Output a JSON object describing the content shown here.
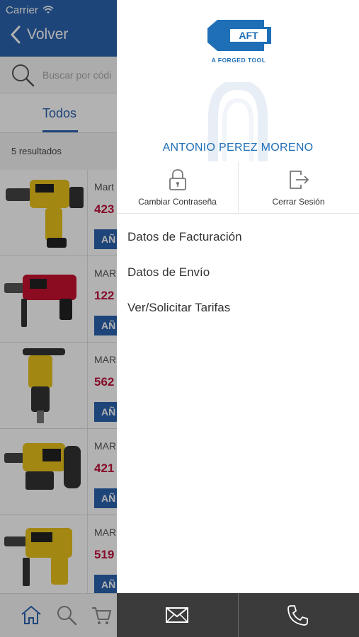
{
  "status_bar": {
    "carrier": "Carrier"
  },
  "nav": {
    "back_label": "Volver"
  },
  "search": {
    "placeholder": "Buscar por códi"
  },
  "tabs": {
    "active": "Todos"
  },
  "results": {
    "count_text": "5 resultados"
  },
  "products": [
    {
      "brand": "Mart",
      "price": "423",
      "add_label": "AÑ"
    },
    {
      "brand": "MAR",
      "price": "122",
      "add_label": "AÑ"
    },
    {
      "brand": "MAR",
      "price": "562",
      "add_label": "AÑ"
    },
    {
      "brand": "MAR",
      "price": "421",
      "add_label": "AÑ"
    },
    {
      "brand": "MAR",
      "price": "519",
      "add_label": "AÑ"
    }
  ],
  "drawer": {
    "logo": {
      "text": "AFT",
      "tagline": "A FORGED TOOL"
    },
    "user_name": "ANTONIO PEREZ MORENO",
    "actions": [
      {
        "label": "Cambiar Contraseña",
        "icon": "lock-icon"
      },
      {
        "label": "Cerrar Sesión",
        "icon": "logout-icon"
      }
    ],
    "menu": [
      {
        "label": "Datos de Facturación"
      },
      {
        "label": "Datos de Envío"
      },
      {
        "label": "Ver/Solicitar Tarifas"
      }
    ],
    "footer": [
      {
        "icon": "mail-icon"
      },
      {
        "icon": "phone-icon"
      }
    ]
  },
  "colors": {
    "brand_blue": "#2b63ae",
    "price_red": "#c0143c",
    "footer_dark": "#3b3b3b"
  }
}
